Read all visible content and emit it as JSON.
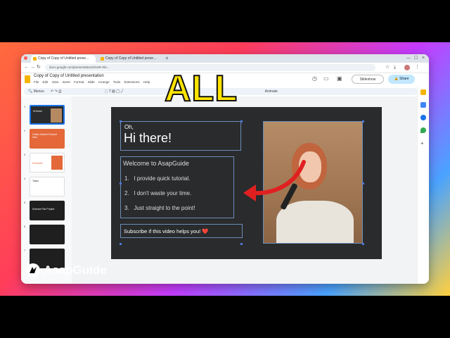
{
  "browser": {
    "tabs": [
      {
        "title": "Copy of Copy of Untitled prese..."
      },
      {
        "title": "Copy of Copy of Untitled prese..."
      }
    ],
    "url": "docs.google.com/presentation/d/1SR-Xkr..."
  },
  "doc": {
    "title": "Copy of Copy of Untitled presentation",
    "menus": [
      "File",
      "Edit",
      "View",
      "Insert",
      "Format",
      "Slide",
      "Arrange",
      "Tools",
      "Extensions",
      "Help"
    ],
    "slideshow_label": "Slideshow",
    "share_label": "Share",
    "zoom_label": "Menus",
    "animate_label": "Animate"
  },
  "overlay": {
    "caption": "ALL"
  },
  "brand": {
    "name": "AsapGuide"
  },
  "thumbs": [
    {
      "n": "1",
      "text": "Hi there!"
    },
    {
      "n": "2",
      "text": "Online Market Product Intro"
    },
    {
      "n": "3",
      "text": "Schedule"
    },
    {
      "n": "4",
      "text": "Tasks"
    },
    {
      "n": "5",
      "text": "Science Fair Project"
    },
    {
      "n": "6",
      "text": ""
    },
    {
      "n": "7",
      "text": ""
    }
  ],
  "slide": {
    "greeting_small": "Oh,",
    "greeting_big": "Hi there!",
    "welcome": "Welcome to AsapGuide",
    "list": [
      {
        "n": "1.",
        "text": "I provide quick tutorial."
      },
      {
        "n": "2.",
        "text": "I don't waste your time."
      },
      {
        "n": "3.",
        "text": "Just straight to the point!"
      }
    ],
    "subscribe": "Subscribe if this video helps you! ❤️"
  },
  "colors": {
    "accent": "#1a73e8",
    "highlight": "#ffe400",
    "arrow": "#e02020"
  }
}
